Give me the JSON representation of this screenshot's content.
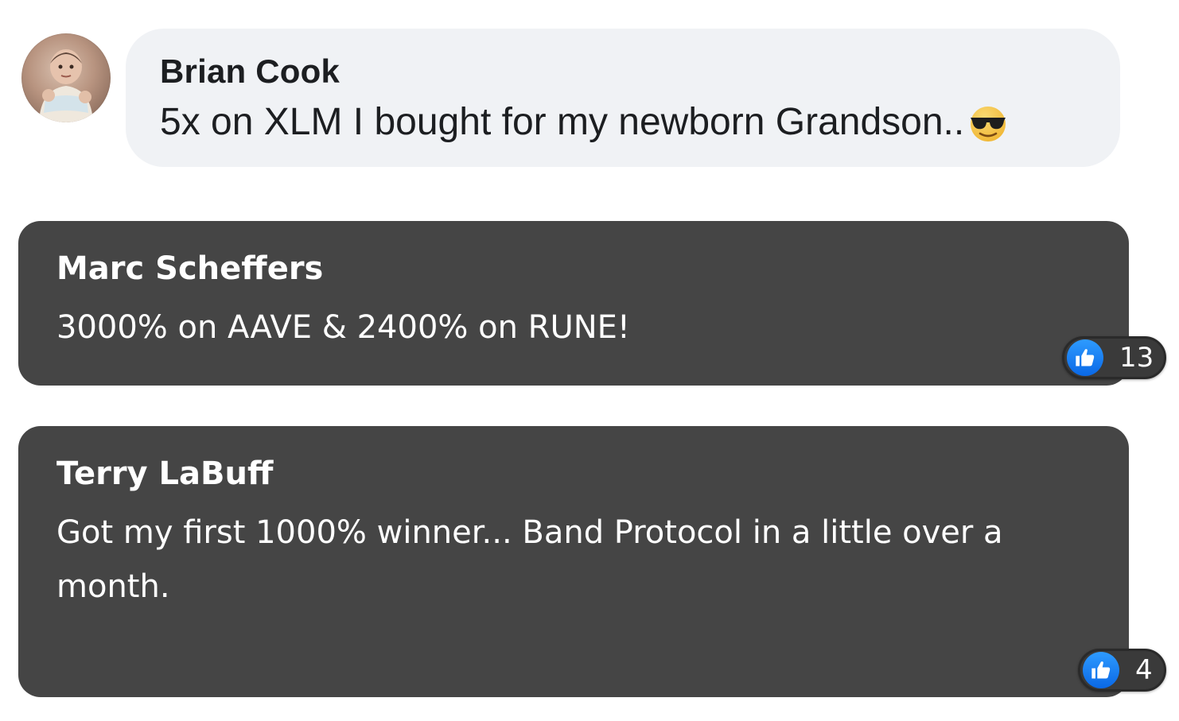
{
  "comments": [
    {
      "author": "Brian Cook",
      "text": "5x on XLM I bought for my newborn Grandson..",
      "emoji": "sunglasses-face-emoji"
    },
    {
      "author": "Marc Scheffers",
      "text": "3000% on AAVE & 2400% on RUNE!",
      "reaction_icon": "thumbs-up-icon",
      "reaction_count": "13"
    },
    {
      "author": "Terry LaBuff",
      "text": "Got my first 1000% winner... Band Protocol in a little over a month.",
      "reaction_icon": "thumbs-up-icon",
      "reaction_count": "4"
    }
  ],
  "colors": {
    "light_bubble": "#f0f2f5",
    "dark_bubble": "#454545",
    "like_blue": "#1877f2"
  }
}
